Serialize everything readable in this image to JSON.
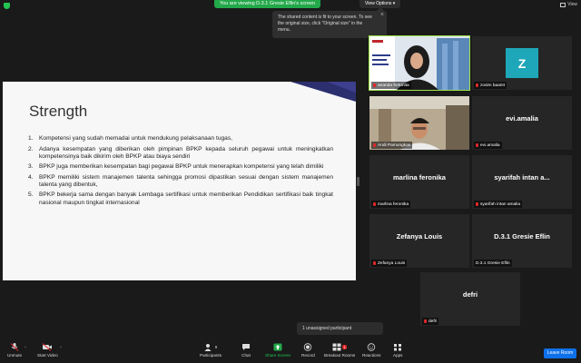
{
  "topbar": {
    "viewing_notice": "You are viewing D.3.1 Gresie Eflin's screen",
    "view_options_label": "View Options",
    "view_label": "View"
  },
  "tooltip": {
    "text": "The shared content is fit to your screen. To see the original size, click \"Original size\" in the menu."
  },
  "slide": {
    "title": "Strength",
    "items": [
      {
        "num": "1.",
        "text": "Kompetensi yang sudah memadai untuk mendukung pelaksanaan tugas,"
      },
      {
        "num": "2.",
        "text": "Adanya kesempatan yang diberikan oleh pimpinan BPKP kepada seluruh pegawai untuk meningkatkan kompetensinya baik dikirim oleh BPKP atau biaya sendiri"
      },
      {
        "num": "3.",
        "text": "BPKP juga memberikan kesempatan bagi pegawai BPKP untuk menerapkan kompetensi yang telah dimiliki"
      },
      {
        "num": "4.",
        "text": "BPKP memiliki sistem manajemen talenta sehingga promosi dipastikan sesuai dengan sistem manajemen talenta yang dibentuk,"
      },
      {
        "num": "5.",
        "text": "BPKP bekerja sama dengan banyak Lembaga sertifikasi untuk memberikan Pendidikan sertifikasi baik tingkat nasional maupun tingkat internasional"
      }
    ]
  },
  "participants": [
    {
      "name": "",
      "label": "ananda fortunita",
      "kind": "video-woman"
    },
    {
      "name": "",
      "label": "zosim baa04",
      "kind": "avatar",
      "avatar_letter": "Z"
    },
    {
      "name": "",
      "label": "Andi Pamungkas",
      "kind": "video-man"
    },
    {
      "name": "evi.amalia",
      "label": "evi.amalia",
      "kind": "name"
    },
    {
      "name": "marlina feronika",
      "label": "marlina feronika",
      "kind": "name"
    },
    {
      "name": "syarifah intan a...",
      "label": "syarifah intan amalia",
      "kind": "name"
    },
    {
      "name": "Zefanya Louis",
      "label": "Zefanya Louis",
      "kind": "name"
    },
    {
      "name": "D.3.1 Gresie Eflin",
      "label": "D.3.1 Gresie Eflin",
      "kind": "name"
    },
    {
      "name": "defri",
      "label": "defri",
      "kind": "name"
    }
  ],
  "unassigned": "1 unassigned participant",
  "toolbar": {
    "unmute": "Unmute",
    "start_video": "Start Video",
    "participants": "Participants",
    "participants_count": "9",
    "chat": "Chat",
    "share_screen": "Share Screen",
    "record": "Record",
    "breakout_rooms": "Breakout Rooms",
    "breakout_badge": "1",
    "reactions": "Reactions",
    "apps": "Apps",
    "leave": "Leave Room"
  },
  "colors": {
    "share_green": "#23a84a",
    "speaking_outline": "#9ee54a",
    "leave_blue": "#0e71eb",
    "avatar_teal": "#1ea7b8",
    "slide_accent": "#2b2f6e"
  }
}
